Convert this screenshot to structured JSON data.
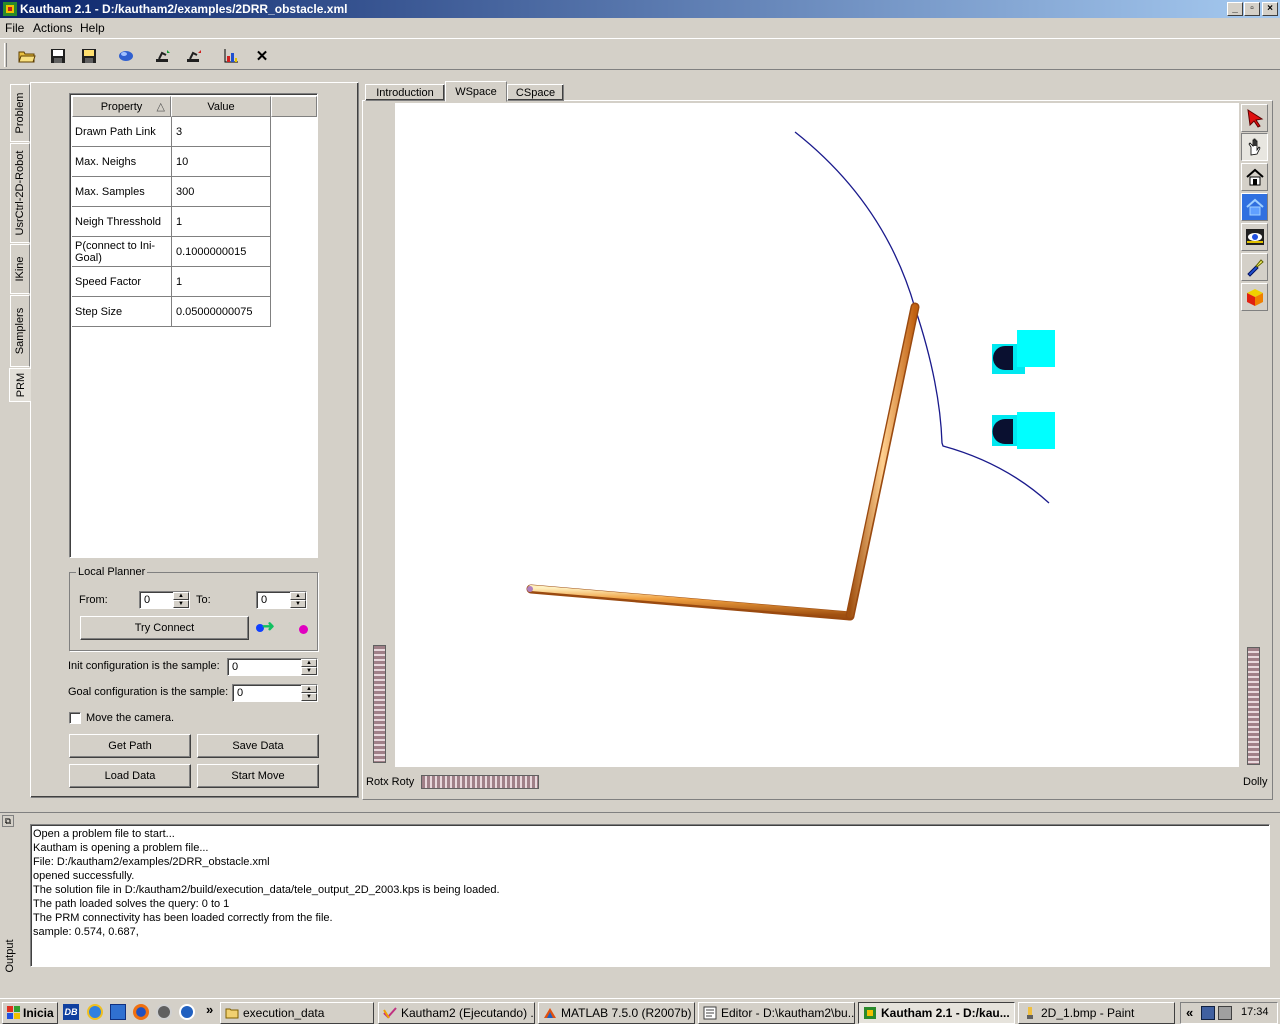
{
  "window": {
    "title": "Kautham 2.1 - D:/kautham2/examples/2DRR_obstacle.xml",
    "min_glyph": "_",
    "max_glyph": "▫",
    "close_glyph": "×"
  },
  "menu": [
    "File",
    "Actions",
    "Help"
  ],
  "toolbar": {
    "icons": [
      "open-folder-icon",
      "save-icon",
      "save-as-icon",
      "sphere-icon",
      "robot-up-icon",
      "robot-down-icon",
      "chart-icon",
      "close-icon"
    ],
    "close_glyph": "✕"
  },
  "side_tabs": [
    "Problem",
    "UsrCtrl-2D-Robot",
    "IKine",
    "Samplers",
    "PRM"
  ],
  "properties": {
    "header_property": "Property",
    "header_value": "Value",
    "sort_glyph": "△",
    "rows": [
      {
        "key": "Drawn Path Link",
        "value": "3"
      },
      {
        "key": "Max. Neighs",
        "value": "10"
      },
      {
        "key": "Max. Samples",
        "value": "300"
      },
      {
        "key": "Neigh Thresshold",
        "value": "1"
      },
      {
        "key": "P(connect to Ini-Goal)",
        "value": "0.1000000015"
      },
      {
        "key": "Speed Factor",
        "value": "1"
      },
      {
        "key": "Step Size",
        "value": "0.05000000075"
      }
    ]
  },
  "local_planner": {
    "title": "Local Planner",
    "from_label": "From:",
    "from_value": "0",
    "to_label": "To:",
    "to_value": "0",
    "try_connect": "Try Connect",
    "arrow_glyph": "➜",
    "dot_color": "#e000c0",
    "start_dot_color": "#1040ff",
    "arrow_color": "#10c060"
  },
  "init_label": "Init configuration is the sample:",
  "init_value": "0",
  "goal_label": "Goal configuration is the sample:",
  "goal_value": "0",
  "move_camera_label": "Move the camera.",
  "move_camera_checked": false,
  "buttons": {
    "get_path": "Get Path",
    "save_data": "Save Data",
    "load_data": "Load Data",
    "start_move": "Start Move"
  },
  "view_tabs": [
    {
      "label": "Introduction",
      "active": false
    },
    {
      "label": "WSpace",
      "active": true
    },
    {
      "label": "CSpace",
      "active": false
    }
  ],
  "viewer_tools": [
    "select-arrow-icon",
    "hand-icon",
    "home-icon",
    "set-home-icon",
    "view-eye-icon",
    "seek-flashlight-icon",
    "projection-cube-icon"
  ],
  "wheel_labels": {
    "left": "Rotx Roty",
    "right": "Dolly"
  },
  "scene_colors": {
    "robot": "#e8902c",
    "obstacle": "#00ffff",
    "obstacle_dark": "#0a1030",
    "path": "#1a1a8c"
  },
  "output": {
    "label": "Output",
    "lines": [
      "Open a problem file to start...",
      "Kautham is opening a problem file...",
      "File: D:/kautham2/examples/2DRR_obstacle.xml",
      "opened successfully.",
      "The solution file in D:/kautham2/build/execution_data/tele_output_2D_2003.kps is being loaded.",
      "The path loaded solves the query: 0 to 1",
      "The PRM connectivity has been loaded correctly from the file.",
      "sample: 0.574, 0.687,"
    ]
  },
  "taskbar": {
    "start": "Inicia",
    "more_glyph": "»",
    "tasks": [
      {
        "label": "execution_data",
        "active": false
      },
      {
        "label": "Kautham2 (Ejecutando) ...",
        "active": false
      },
      {
        "label": "MATLAB  7.5.0 (R2007b)",
        "active": false
      },
      {
        "label": "Editor - D:\\kautham2\\bu...",
        "active": false
      },
      {
        "label": "Kautham 2.1 - D:/kau...",
        "active": true
      },
      {
        "label": "2D_1.bmp - Paint",
        "active": false
      }
    ],
    "tray_glyph": "«",
    "clock": "17:34"
  }
}
